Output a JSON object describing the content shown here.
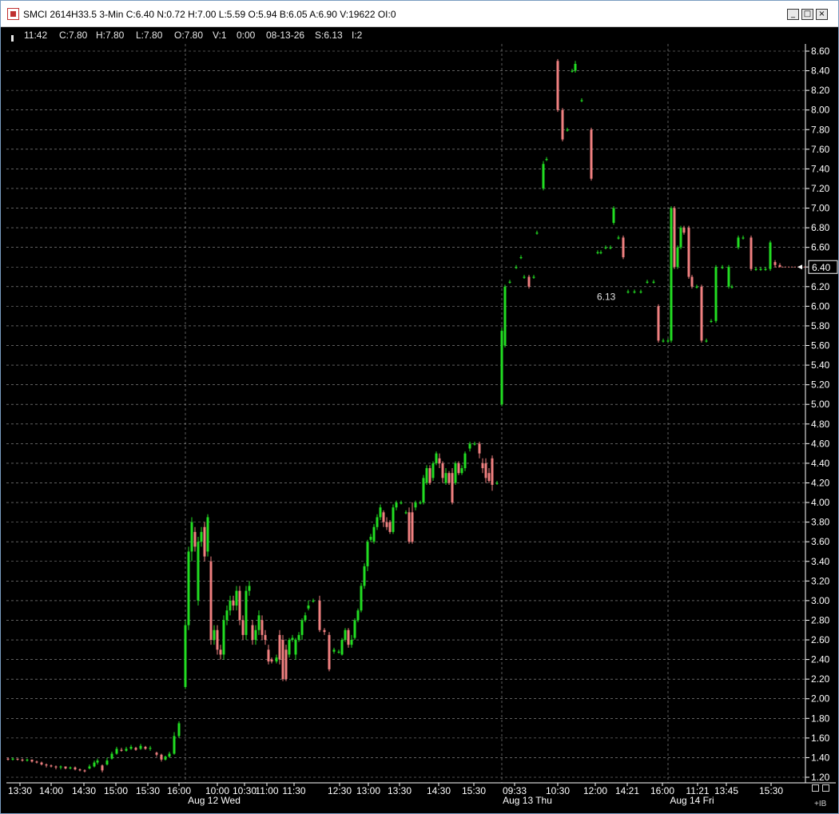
{
  "window": {
    "title": "SMCI 2614H33.5 3-Min C:6.40 N:0.72 H:7.00 L:5.59 O:5.94 B:6.05 A:6.90 V:19622 OI:0",
    "minimize": "_",
    "maximize": "□",
    "close": "×"
  },
  "infobar": {
    "time": "11:42",
    "close": "C:7.80",
    "high": "H:7.80",
    "low": "L:7.80",
    "open": "O:7.80",
    "volume": "V:1",
    "extra": "0:00",
    "date": "08-13-26",
    "settle": "S:6.13",
    "interval": "I:2"
  },
  "corner_label": "+IB",
  "chart_data": {
    "type": "candlestick",
    "title": "",
    "ylim": [
      1.2,
      8.6
    ],
    "y_ticks": [
      "1.20",
      "1.40",
      "1.60",
      "1.80",
      "2.00",
      "2.20",
      "2.40",
      "2.60",
      "2.80",
      "3.00",
      "3.20",
      "3.40",
      "3.60",
      "3.80",
      "4.00",
      "4.20",
      "4.40",
      "4.60",
      "4.80",
      "5.00",
      "5.20",
      "5.40",
      "5.60",
      "5.80",
      "6.00",
      "6.20",
      "6.40",
      "6.60",
      "6.80",
      "7.00",
      "7.20",
      "7.40",
      "7.60",
      "7.80",
      "8.00",
      "8.20",
      "8.40",
      "8.60"
    ],
    "last_price": "6.40",
    "settle_label": "6.13",
    "x_ticks": [
      "13:30",
      "14:00",
      "14:30",
      "15:00",
      "15:30",
      "16:00",
      "10:00",
      "10:30",
      "11:00",
      "11:30",
      "12:30",
      "13:00",
      "13:30",
      "14:30",
      "15:30",
      "09:33",
      "10:30",
      "12:00",
      "14:21",
      "16:00",
      "11:21",
      "13:45",
      "15:30"
    ],
    "date_labels": [
      "Aug 12 Wed",
      "Aug 13 Thu",
      "Aug 14 Fri"
    ],
    "up_color": "#22dd22",
    "down_color": "#f08080",
    "grid": true
  }
}
